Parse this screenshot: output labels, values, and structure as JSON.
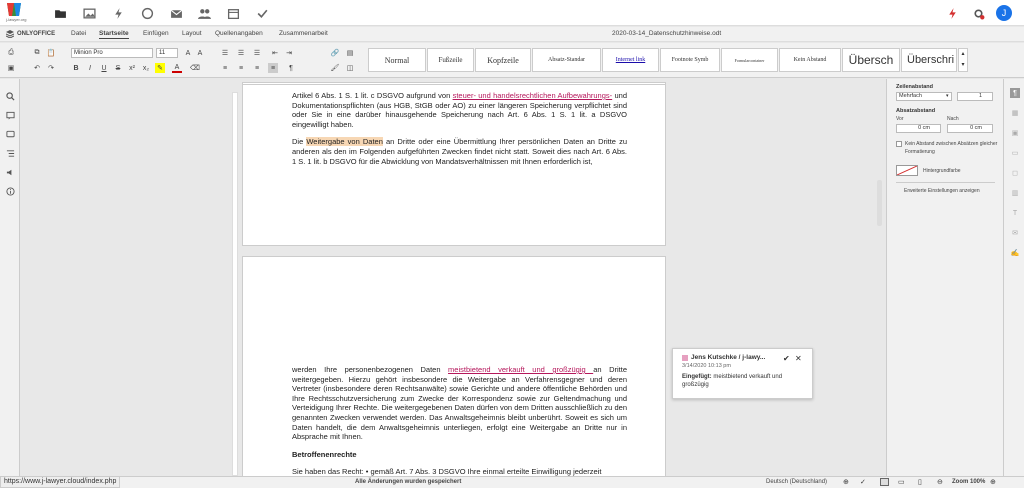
{
  "app": {
    "name": "j-lawyer.org",
    "avatar_initial": "J"
  },
  "menu": {
    "brand": "ONLYOFFICE",
    "items": [
      "Datei",
      "Startseite",
      "Einfügen",
      "Layout",
      "Quellenangaben",
      "Zusammenarbeit"
    ],
    "active": "Startseite",
    "document_title": "2020-03-14_Datenschutzhinweise.odt"
  },
  "toolbar": {
    "font_name": "Minion Pro",
    "font_size": "11",
    "styles": [
      "Normal",
      "Fußzeile",
      "Kopfzeile",
      "Absatz-Standar",
      "Internet link",
      "Footnote Symb",
      "Formularcontainer",
      "Kein Abstand",
      "Übersch",
      "Überschri"
    ]
  },
  "document": {
    "page1_paragraph1": [
      "Artikel 6 Abs. 1 S. 1 lit. c DSGVO aufgrund von ",
      "steuer- und handelsrechtlichen Aufbewahrungs-",
      " und Dokumentationspflichten (aus HGB, StGB oder AO) zu einer längeren Speicherung verpflichtet sind oder Sie in eine darüber hinausgehende Speicherung nach Art. 6 Abs. 1 S. 1 lit. a DSGVO eingewilligt haben."
    ],
    "page1_paragraph2": [
      "Die ",
      "Weitergabe von Daten",
      " an Dritte oder eine Übermittlung Ihrer persönlichen Daten an Dritte zu anderen als den im Folgenden aufgeführten Zwecken findet nicht statt. Soweit dies nach Art. 6 Abs. 1 S. 1 lit. b DSGVO für die Abwicklung von Mandatsverhältnissen mit Ihnen erforderlich ist,"
    ],
    "page2_paragraph1": [
      "werden Ihre personenbezogenen Daten ",
      "meistbietend verkauft und großzügig ",
      "an Dritte weitergegeben. Hierzu gehört insbesondere die Weitergabe an Verfahrensgegner und deren Vertreter (insbesondere deren Rechtsanwälte) sowie Gerichte und andere öffentliche Behörden und Ihre Rechtsschutzversicherung zum Zwecke der Korrespondenz sowie zur Geltendmachung und Verteidigung Ihrer Rechte. Die weitergegebenen Daten dürfen von dem Dritten ausschließlich zu den genannten Zwecken verwendet werden. Das Anwaltsgeheimnis bleibt unberührt. Soweit es sich um Daten handelt, die dem Anwaltsgeheimnis unterliegen, erfolgt eine Weitergabe an Dritte nur in Absprache mit Ihnen."
    ],
    "heading": "Betroffenenrechte",
    "page2_paragraph2": "Sie haben das Recht: • gemäß Art. 7 Abs. 3 DSGVO Ihre einmal erteilte Einwilligung jederzeit"
  },
  "comment": {
    "author": "Jens Kutschke / j-lawy...",
    "date": "3/14/2020 10:13 pm",
    "label": "Eingefügt:",
    "text": " meistbietend verkauft und großzügig"
  },
  "right_panel": {
    "line_spacing_title": "Zeilenabstand",
    "line_spacing_mode": "Mehrfach",
    "line_spacing_value": "1",
    "paragraph_spacing_title": "Absatzabstand",
    "before_label": "Vor",
    "after_label": "Nach",
    "before_value": "0 cm",
    "after_value": "0 cm",
    "no_spacing_checkbox": "Kein Abstand zwischen Absätzen gleicher Formatierung",
    "background_color": "Hintergrundfarbe",
    "advanced_link": "Erweiterte Einstellungen anzeigen"
  },
  "status": {
    "url_tooltip": "https://www.j-lawyer.cloud/index.php",
    "saved_message": "Alle Änderungen wurden gespeichert",
    "language": "Deutsch (Deutschland)",
    "zoom": "Zoom 100%"
  },
  "colors": {
    "avatar_blue": "#1a73e8",
    "highlight": "#f7d7b4",
    "insert_mark": "#b5175b"
  }
}
